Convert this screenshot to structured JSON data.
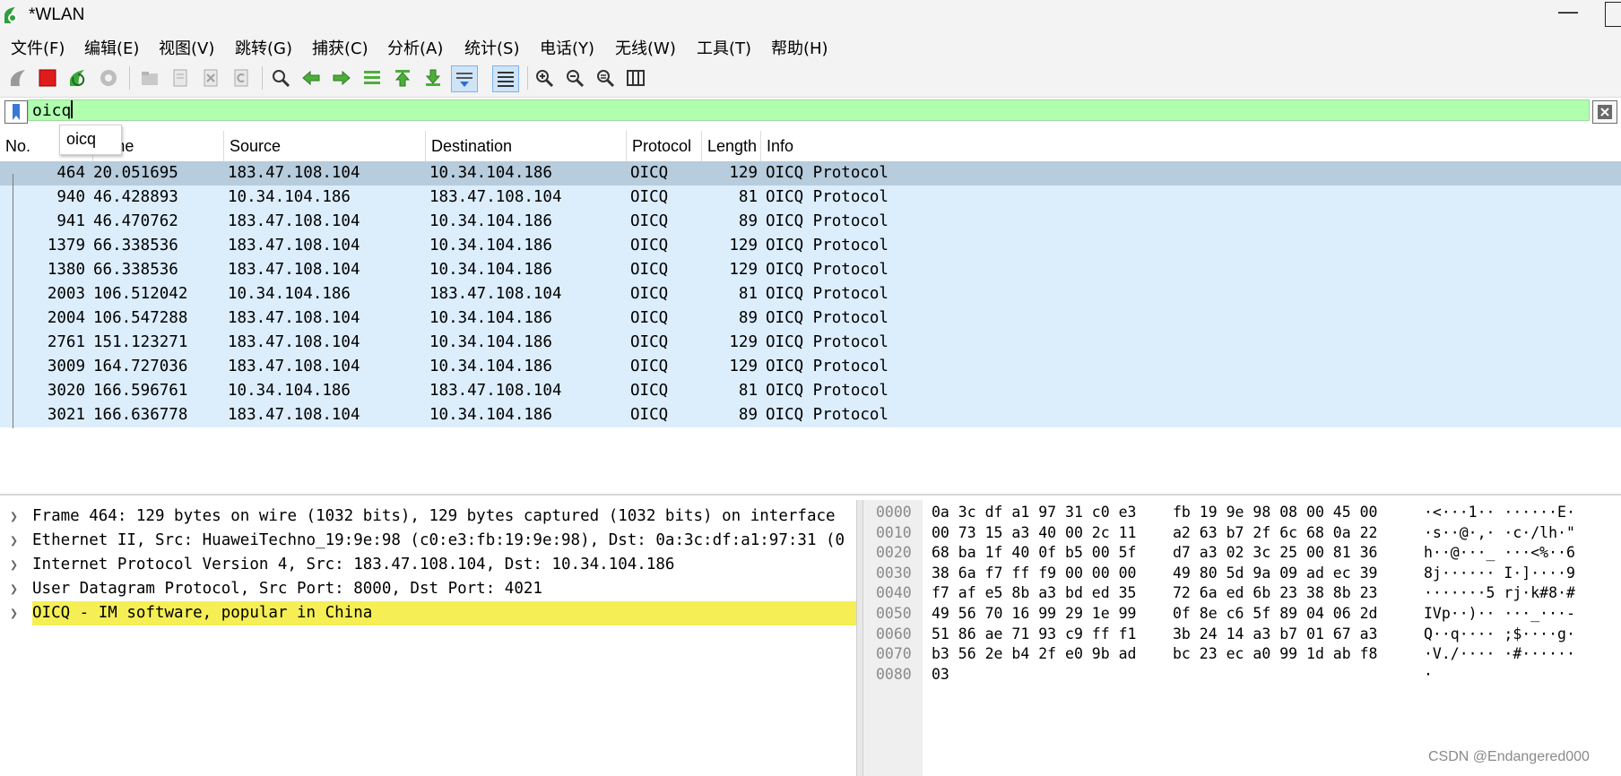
{
  "window": {
    "title": "*WLAN",
    "minimize": "—"
  },
  "menu": [
    "文件(F)",
    "编辑(E)",
    "视图(V)",
    "跳转(G)",
    "捕获(C)",
    "分析(A)",
    "统计(S)",
    "电话(Y)",
    "无线(W)",
    "工具(T)",
    "帮助(H)"
  ],
  "toolbar": {
    "icons": [
      "shark-fin-start-icon",
      "stop-capture-icon",
      "restart-capture-icon",
      "capture-options-icon",
      "open-file-icon",
      "save-file-icon",
      "close-file-icon",
      "reload-file-icon",
      "find-packet-icon",
      "go-back-icon",
      "go-forward-icon",
      "go-to-packet-icon",
      "go-first-icon",
      "go-last-icon",
      "auto-scroll-icon",
      "colorize-icon",
      "zoom-in-icon",
      "zoom-out-icon",
      "normal-size-icon",
      "resize-columns-icon"
    ]
  },
  "filter": {
    "value": "oicq",
    "suggestion": "oicq"
  },
  "packet_list": {
    "columns": [
      "No.",
      "Time",
      "Source",
      "Destination",
      "Protocol",
      "Length",
      "Info"
    ],
    "rows": [
      {
        "no": "464",
        "time": "20.051695",
        "src": "183.47.108.104",
        "dst": "10.34.104.186",
        "proto": "OICQ",
        "len": "129",
        "info": "OICQ Protocol",
        "selected": true
      },
      {
        "no": "940",
        "time": "46.428893",
        "src": "10.34.104.186",
        "dst": "183.47.108.104",
        "proto": "OICQ",
        "len": "81",
        "info": "OICQ Protocol"
      },
      {
        "no": "941",
        "time": "46.470762",
        "src": "183.47.108.104",
        "dst": "10.34.104.186",
        "proto": "OICQ",
        "len": "89",
        "info": "OICQ Protocol"
      },
      {
        "no": "1379",
        "time": "66.338536",
        "src": "183.47.108.104",
        "dst": "10.34.104.186",
        "proto": "OICQ",
        "len": "129",
        "info": "OICQ Protocol"
      },
      {
        "no": "1380",
        "time": "66.338536",
        "src": "183.47.108.104",
        "dst": "10.34.104.186",
        "proto": "OICQ",
        "len": "129",
        "info": "OICQ Protocol"
      },
      {
        "no": "2003",
        "time": "106.512042",
        "src": "10.34.104.186",
        "dst": "183.47.108.104",
        "proto": "OICQ",
        "len": "81",
        "info": "OICQ Protocol"
      },
      {
        "no": "2004",
        "time": "106.547288",
        "src": "183.47.108.104",
        "dst": "10.34.104.186",
        "proto": "OICQ",
        "len": "89",
        "info": "OICQ Protocol"
      },
      {
        "no": "2761",
        "time": "151.123271",
        "src": "183.47.108.104",
        "dst": "10.34.104.186",
        "proto": "OICQ",
        "len": "129",
        "info": "OICQ Protocol"
      },
      {
        "no": "3009",
        "time": "164.727036",
        "src": "183.47.108.104",
        "dst": "10.34.104.186",
        "proto": "OICQ",
        "len": "129",
        "info": "OICQ Protocol"
      },
      {
        "no": "3020",
        "time": "166.596761",
        "src": "10.34.104.186",
        "dst": "183.47.108.104",
        "proto": "OICQ",
        "len": "81",
        "info": "OICQ Protocol"
      },
      {
        "no": "3021",
        "time": "166.636778",
        "src": "183.47.108.104",
        "dst": "10.34.104.186",
        "proto": "OICQ",
        "len": "89",
        "info": "OICQ Protocol"
      }
    ]
  },
  "details": [
    {
      "text": "Frame 464: 129 bytes on wire (1032 bits), 129 bytes captured (1032 bits) on interface",
      "highlight": false
    },
    {
      "text": "Ethernet II, Src: HuaweiTechno_19:9e:98 (c0:e3:fb:19:9e:98), Dst: 0a:3c:df:a1:97:31 (0",
      "highlight": false
    },
    {
      "text": "Internet Protocol Version 4, Src: 183.47.108.104, Dst: 10.34.104.186",
      "highlight": false
    },
    {
      "text": "User Datagram Protocol, Src Port: 8000, Dst Port: 4021",
      "highlight": false
    },
    {
      "text": "OICQ - IM software, popular in China",
      "highlight": true
    }
  ],
  "bytes": [
    {
      "off": "0000",
      "hex1": "0a 3c df a1 97 31 c0 e3",
      "hex2": "fb 19 9e 98 08 00 45 00",
      "ascii": "·<···1·· ······E·"
    },
    {
      "off": "0010",
      "hex1": "00 73 15 a3 40 00 2c 11",
      "hex2": "a2 63 b7 2f 6c 68 0a 22",
      "ascii": "·s··@·,· ·c·/lh·\""
    },
    {
      "off": "0020",
      "hex1": "68 ba 1f 40 0f b5 00 5f",
      "hex2": "d7 a3 02 3c 25 00 81 36",
      "ascii": "h··@···_ ···<%··6"
    },
    {
      "off": "0030",
      "hex1": "38 6a f7 ff f9 00 00 00",
      "hex2": "49 80 5d 9a 09 ad ec 39",
      "ascii": "8j······ I·]····9"
    },
    {
      "off": "0040",
      "hex1": "f7 af e5 8b a3 bd ed 35",
      "hex2": "72 6a ed 6b 23 38 8b 23",
      "ascii": "·······5 rj·k#8·#"
    },
    {
      "off": "0050",
      "hex1": "49 56 70 16 99 29 1e 99",
      "hex2": "0f 8e c6 5f 89 04 06 2d",
      "ascii": "IVp··)·· ···_···-"
    },
    {
      "off": "0060",
      "hex1": "51 86 ae 71 93 c9 ff f1",
      "hex2": "3b 24 14 a3 b7 01 67 a3",
      "ascii": "Q··q···· ;$····g·"
    },
    {
      "off": "0070",
      "hex1": "b3 56 2e b4 2f e0 9b ad",
      "hex2": "bc 23 ec a0 99 1d ab f8",
      "ascii": "·V./···· ·#······"
    },
    {
      "off": "0080",
      "hex1": "03",
      "hex2": "",
      "ascii": "·"
    }
  ],
  "watermark": "CSDN @Endangered000",
  "colors": {
    "row_bg": "#dcedfc",
    "selected_row_bg": "#b7ccdc",
    "filter_ok_bg": "#afffaf",
    "detail_highlight": "#f5ef55"
  }
}
